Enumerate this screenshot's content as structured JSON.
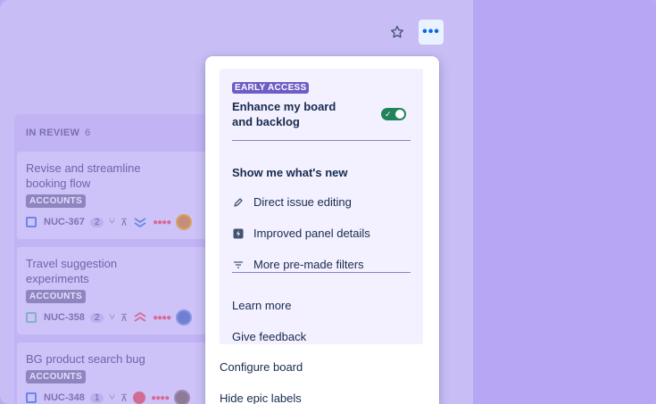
{
  "column": {
    "title": "IN REVIEW",
    "count": "6",
    "cards": [
      {
        "title": "Revise and streamline booking flow",
        "label": "ACCOUNTS",
        "key": "NUC-367",
        "estimate": "2"
      },
      {
        "title": "Travel suggestion experiments",
        "label": "ACCOUNTS",
        "key": "NUC-358",
        "estimate": "2"
      },
      {
        "title": "BG product search bug",
        "label": "ACCOUNTS",
        "key": "NUC-348",
        "estimate": "1"
      }
    ]
  },
  "menu": {
    "badge": "EARLY ACCESS",
    "promo_title": "Enhance my board and backlog",
    "toggle_on": true,
    "whats_new_heading": "Show me what's new",
    "features": [
      {
        "label": "Direct issue editing",
        "icon": "pencil-icon"
      },
      {
        "label": "Improved panel details",
        "icon": "panel-lightning-icon"
      },
      {
        "label": "More pre-made filters",
        "icon": "filter-icon"
      }
    ],
    "learn_more": "Learn more",
    "give_feedback": "Give feedback",
    "configure_board": "Configure board",
    "hide_epic_labels": "Hide epic labels"
  },
  "toolbar": {
    "star_icon": "star-icon",
    "more_label": "•••"
  },
  "colors": {
    "accent": "#6e5dc6",
    "toggle_on": "#1f845a",
    "overlay": "#bba9f5"
  }
}
